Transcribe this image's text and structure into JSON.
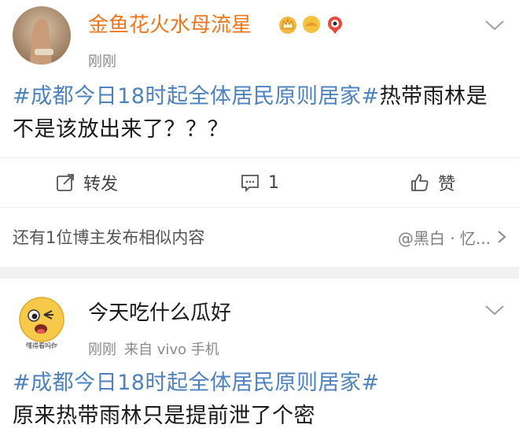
{
  "post1": {
    "username": "金鱼花火水母流星",
    "time": "刚刚",
    "topic": "#成都今日18时起全体居民原则居家#",
    "text": "热带雨林是不是该放出来了？？？",
    "actions": {
      "repost": "转发",
      "comment": "1",
      "like": "赞"
    },
    "related": {
      "text": "还有1位博主发布相似内容",
      "mention": "@黑白 · 忆..."
    }
  },
  "post2": {
    "username": "今天吃什么瓜好",
    "time": "刚刚",
    "source": "来自 vivo 手机",
    "topic": "#成都今日18时起全体居民原则居家#",
    "text": "原来热带雨林只是提前泄了个密",
    "avatar_caption": "懂得看吗你"
  },
  "colors": {
    "username_orange": "#f0761c",
    "topic_blue": "#4d82c0",
    "meta_gray": "#8a8a8a"
  }
}
